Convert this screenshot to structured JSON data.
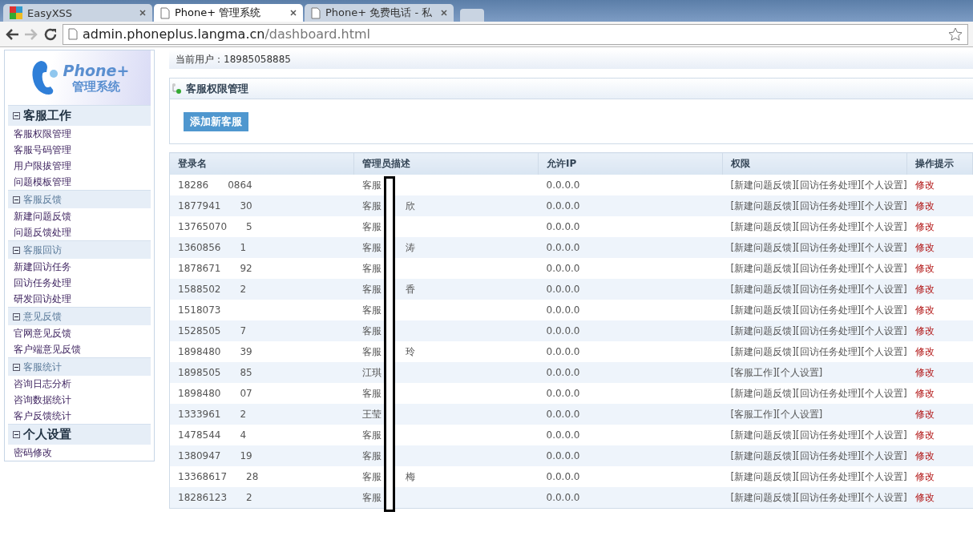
{
  "browser": {
    "tabs": [
      {
        "title": "EasyXSS",
        "selected": false,
        "kind": "favicon"
      },
      {
        "title": "Phone+ 管理系统",
        "selected": true,
        "kind": "page"
      },
      {
        "title": "Phone+ 免费电话 - 私",
        "selected": false,
        "kind": "page"
      }
    ],
    "url_host": "admin.phoneplus.langma.cn",
    "url_path": "/dashboard.html"
  },
  "sidebar": {
    "logo_title": "Phone+",
    "logo_subtitle": "管理系统",
    "sections": [
      {
        "title": "客服工作",
        "kind": "major",
        "expanded": true,
        "items": [
          "客服权限管理",
          "客服号码管理",
          "用户限拔管理",
          "问题模板管理"
        ]
      },
      {
        "title": "客服反馈",
        "kind": "minor",
        "expanded": true,
        "items": [
          "新建问题反馈",
          "问题反馈处理"
        ]
      },
      {
        "title": "客服回访",
        "kind": "minor",
        "expanded": true,
        "items": [
          "新建回访任务",
          "回访任务处理",
          "研发回访处理"
        ]
      },
      {
        "title": "意见反馈",
        "kind": "minor",
        "expanded": true,
        "items": [
          "官网意见反馈",
          "客户端意见反馈"
        ]
      },
      {
        "title": "客服统计",
        "kind": "minor",
        "expanded": true,
        "items": [
          "咨询日志分析",
          "咨询数据统计",
          "客户反馈统计"
        ]
      },
      {
        "title": "个人设置",
        "kind": "major",
        "expanded": true,
        "items": [
          "密码修改"
        ]
      }
    ]
  },
  "user_bar": {
    "label": "当前用户：",
    "value": "18985058885"
  },
  "panel": {
    "title": "客服权限管理",
    "add_button": "添加新客服"
  },
  "table": {
    "columns": [
      "登录名",
      "管理员描述",
      "允许IP",
      "权限",
      "操作提示"
    ],
    "rows": [
      {
        "login": [
          "18286",
          "0864"
        ],
        "desc": [
          "客服"
        ],
        "ip": "0.0.0.0",
        "perm": "[新建问题反馈][回访任务处理][个人设置]",
        "action": "修改"
      },
      {
        "login": [
          "1877941",
          "30"
        ],
        "desc": [
          "客服",
          "欣"
        ],
        "ip": "0.0.0.0",
        "perm": "[新建问题反馈][回访任务处理][个人设置]",
        "action": "修改"
      },
      {
        "login": [
          "13765070",
          "5"
        ],
        "desc": [
          "客服"
        ],
        "ip": "0.0.0.0",
        "perm": "[新建问题反馈][回访任务处理][个人设置]",
        "action": "修改"
      },
      {
        "login": [
          "1360856",
          "1"
        ],
        "desc": [
          "客服",
          "涛"
        ],
        "ip": "0.0.0.0",
        "perm": "[新建问题反馈][回访任务处理][个人设置]",
        "action": "修改"
      },
      {
        "login": [
          "1878671",
          "92"
        ],
        "desc": [
          "客服"
        ],
        "ip": "0.0.0.0",
        "perm": "[新建问题反馈][回访任务处理][个人设置]",
        "action": "修改"
      },
      {
        "login": [
          "1588502",
          "2"
        ],
        "desc": [
          "客服",
          "香"
        ],
        "ip": "0.0.0.0",
        "perm": "[新建问题反馈][回访任务处理][个人设置]",
        "action": "修改"
      },
      {
        "login": [
          "1518073"
        ],
        "desc": [
          "客服"
        ],
        "ip": "0.0.0.0",
        "perm": "[新建问题反馈][回访任务处理][个人设置]",
        "action": "修改"
      },
      {
        "login": [
          "1528505",
          "7"
        ],
        "desc": [
          "客服"
        ],
        "ip": "0.0.0.0",
        "perm": "[新建问题反馈][回访任务处理][个人设置]",
        "action": "修改"
      },
      {
        "login": [
          "1898480",
          "39"
        ],
        "desc": [
          "客服",
          "玲"
        ],
        "ip": "0.0.0.0",
        "perm": "[新建问题反馈][回访任务处理][个人设置]",
        "action": "修改"
      },
      {
        "login": [
          "1898505",
          "85"
        ],
        "desc": [
          "江琪"
        ],
        "ip": "0.0.0.0",
        "perm": "[客服工作][个人设置]",
        "action": "修改"
      },
      {
        "login": [
          "1898480",
          "07"
        ],
        "desc": [
          "客服"
        ],
        "ip": "0.0.0.0",
        "perm": "[新建问题反馈][回访任务处理][个人设置]",
        "action": "修改"
      },
      {
        "login": [
          "1333961",
          "2"
        ],
        "desc": [
          "王莹"
        ],
        "ip": "0.0.0.0",
        "perm": "[客服工作][个人设置]",
        "action": "修改"
      },
      {
        "login": [
          "1478544",
          "4"
        ],
        "desc": [
          "客服"
        ],
        "ip": "0.0.0.0",
        "perm": "[新建问题反馈][回访任务处理][个人设置]",
        "action": "修改"
      },
      {
        "login": [
          "1380947",
          "19"
        ],
        "desc": [
          "客服"
        ],
        "ip": "0.0.0.0",
        "perm": "[新建问题反馈][回访任务处理][个人设置]",
        "action": "修改"
      },
      {
        "login": [
          "13368617",
          "28"
        ],
        "desc": [
          "客服",
          "梅"
        ],
        "ip": "0.0.0.0",
        "perm": "[新建问题反馈][回访任务处理][个人设置]",
        "action": "修改"
      },
      {
        "login": [
          "18286123",
          "2"
        ],
        "desc": [
          "客服"
        ],
        "ip": "0.0.0.0",
        "perm": "[新建问题反馈][回访任务处理][个人设置]",
        "action": "修改"
      }
    ]
  }
}
